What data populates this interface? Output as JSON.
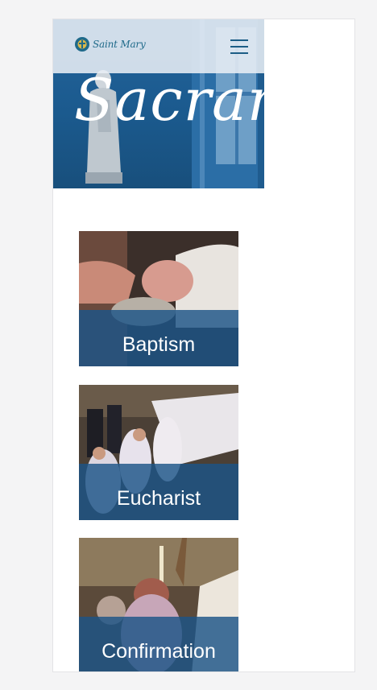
{
  "header": {
    "logo_text": "Saint Mary",
    "menu_icon": "hamburger-menu-icon"
  },
  "hero": {
    "title": "Sacraments"
  },
  "sacraments": [
    {
      "label": "Baptism"
    },
    {
      "label": "Eucharist"
    },
    {
      "label": "Confirmation"
    }
  ],
  "colors": {
    "brand_blue": "#1c5d86",
    "hero_blue": "#1b5a8e",
    "label_band": "#1c5487"
  }
}
